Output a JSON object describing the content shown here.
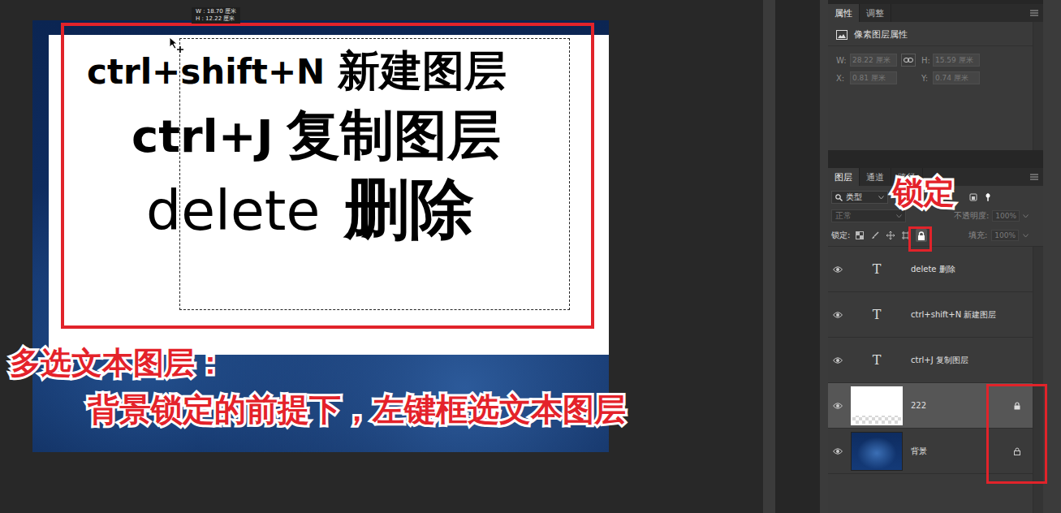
{
  "document": {
    "tooltip": [
      "W : 18.70 厘米",
      "H : 12.22 厘米"
    ],
    "lines": [
      {
        "shortcut": "ctrl+shift+N",
        "label": "新建图层"
      },
      {
        "shortcut": "ctrl+J",
        "label": "复制图层"
      },
      {
        "shortcut": "delete",
        "label": "删除"
      }
    ],
    "selection_active": true
  },
  "annotations": {
    "title": "多选文本图层：",
    "note": "背景锁定的前提下，左键框选文本图层",
    "lock_callout": "锁定"
  },
  "properties": {
    "tabs": [
      {
        "label": "属性",
        "selected": true
      },
      {
        "label": "调整",
        "selected": false
      }
    ],
    "heading": "像素图层属性",
    "size": [
      {
        "label": "W:",
        "value": "28.22 厘米",
        "disabled": true
      },
      {
        "label": "H:",
        "value": "15.59 厘米",
        "disabled": true
      }
    ],
    "position": [
      {
        "label": "X:",
        "value": "0.81 厘米",
        "disabled": true
      },
      {
        "label": "Y:",
        "value": "0.74 厘米",
        "disabled": true
      }
    ]
  },
  "layers_panel": {
    "tabs": [
      {
        "label": "图层",
        "selected": true
      },
      {
        "label": "通道",
        "selected": false
      },
      {
        "label": "路径",
        "selected": false
      }
    ],
    "filter": "类型",
    "blend_mode": {
      "value": "正常",
      "disabled": true
    },
    "opacity": {
      "label": "不透明度:",
      "value": "100%",
      "disabled": true
    },
    "lock_label": "锁定:",
    "lock_buttons": [
      {
        "kind": "pixels",
        "selected": false
      },
      {
        "kind": "paint",
        "selected": false
      },
      {
        "kind": "move",
        "selected": false
      },
      {
        "kind": "artboard",
        "selected": false
      },
      {
        "kind": "all",
        "selected": true
      }
    ],
    "fill": {
      "label": "填充:",
      "value": "100%",
      "disabled": true
    },
    "layers": [
      {
        "name": "delete 删除",
        "kind": "text",
        "icon": "T",
        "visible": true,
        "selected": false,
        "locked": false
      },
      {
        "name": "ctrl+shift+N 新建图层",
        "kind": "text",
        "icon": "T",
        "visible": true,
        "selected": false,
        "locked": false
      },
      {
        "name": "ctrl+J 复制图层",
        "kind": "text",
        "icon": "T",
        "visible": true,
        "selected": false,
        "locked": false
      },
      {
        "name": "222",
        "kind": "pixel",
        "visible": true,
        "selected": true,
        "locked": true
      },
      {
        "name": "背景",
        "kind": "background",
        "visible": true,
        "selected": false,
        "locked": true
      }
    ]
  }
}
